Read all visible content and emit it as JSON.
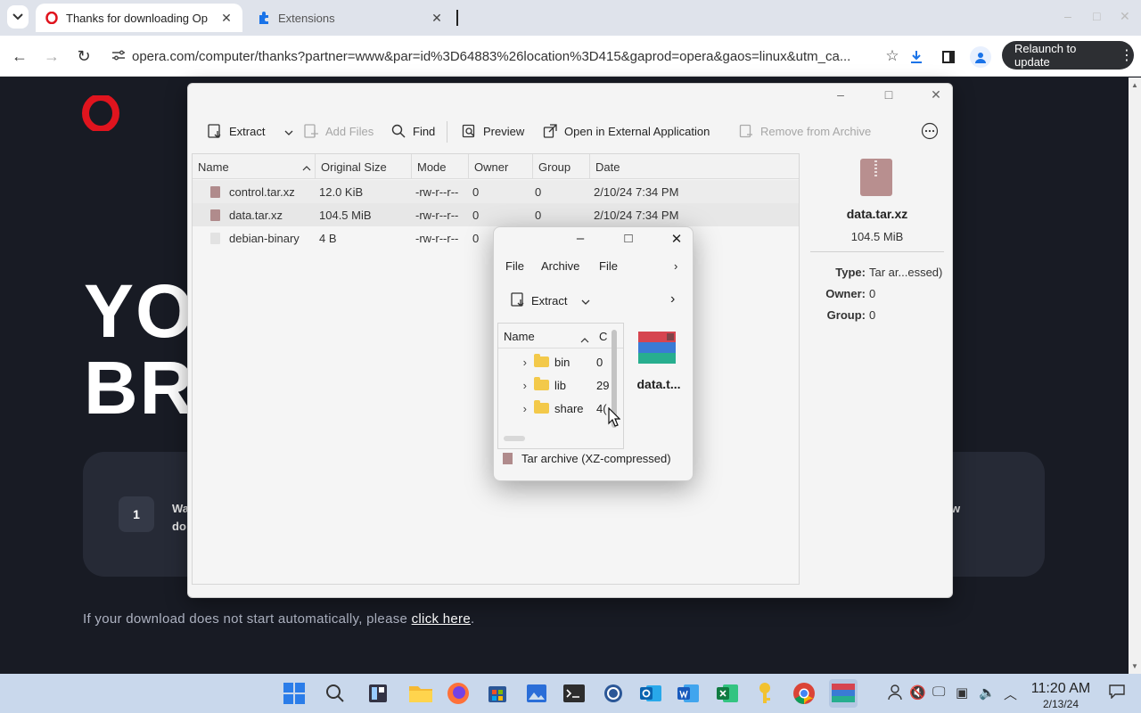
{
  "browser": {
    "tabs": [
      {
        "title": "Thanks for downloading Op",
        "active": true,
        "icon": "opera-icon"
      },
      {
        "title": "Extensions",
        "active": false,
        "icon": "puzzle-icon"
      }
    ],
    "url": "opera.com/computer/thanks?partner=www&par=id%3D64883%26location%3D415&gaprod=opera&gaos=linux&utm_ca...",
    "relaunch_label": "Relaunch to update"
  },
  "page": {
    "hero_line1": "YO",
    "hero_line2": "BR",
    "step_number": "1",
    "step_text_line1": "Wa",
    "step_text_line2": "do",
    "step_text_right": "w",
    "note_prefix": "If your download does not start automatically, please ",
    "note_link": "click here",
    "note_suffix": "."
  },
  "ark": {
    "toolbar": {
      "extract": "Extract",
      "add_files": "Add Files",
      "find": "Find",
      "preview": "Preview",
      "open_external": "Open in External Application",
      "remove": "Remove from Archive"
    },
    "columns": [
      "Name",
      "Original Size",
      "Mode",
      "Owner",
      "Group",
      "Date"
    ],
    "files": [
      {
        "name": "control.tar.xz",
        "size": "12.0 KiB",
        "mode": "-rw-r--r--",
        "owner": "0",
        "group": "0",
        "date": "2/10/24 7:34 PM"
      },
      {
        "name": "data.tar.xz",
        "size": "104.5 MiB",
        "mode": "-rw-r--r--",
        "owner": "0",
        "group": "0",
        "date": "2/10/24 7:34 PM"
      },
      {
        "name": "debian-binary",
        "size": "4 B",
        "mode": "-rw-r--r--",
        "owner": "0",
        "group": "0",
        "date": ""
      }
    ],
    "info": {
      "name": "data.tar.xz",
      "size": "104.5 MiB",
      "type_label": "Type:",
      "type_value": "Tar ar...essed)",
      "owner_label": "Owner:",
      "owner_value": "0",
      "group_label": "Group:",
      "group_value": "0"
    }
  },
  "popup": {
    "menu": [
      "File",
      "Archive",
      "File"
    ],
    "extract": "Extract",
    "list_header": "Name",
    "list_header_2": "C",
    "items": [
      {
        "name": "bin",
        "extra": "0"
      },
      {
        "name": "lib",
        "extra": "29"
      },
      {
        "name": "share",
        "extra": "4("
      }
    ],
    "thumb_name": "data.t...",
    "status": "Tar archive (XZ-compressed)"
  },
  "taskbar": {
    "time": "11:20 AM",
    "date": "2/13/24"
  },
  "colors": {
    "page_bg": "#181b24",
    "opera_red": "#e0141e",
    "accent": "#1a73e8",
    "taskbar": "#c9d8ec"
  }
}
